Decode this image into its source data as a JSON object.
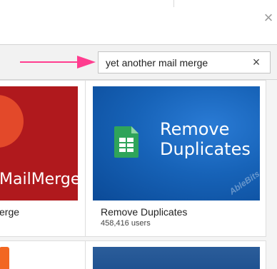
{
  "dialog": {
    "close_icon": "close-icon"
  },
  "search": {
    "value": "yet another mail merge",
    "clear_icon": "close-icon",
    "arrow_color": "#ff3d8f"
  },
  "cards": [
    {
      "thumbnail_text": "MailMerge",
      "title": "erge",
      "color": "#b0191d"
    },
    {
      "thumbnail_text": "Remove Duplicates",
      "watermark": "AbleBits",
      "title": "Remove Duplicates",
      "users": "458,416 users",
      "color": "#1763b8"
    }
  ],
  "glyphs": {
    "close": "×"
  }
}
